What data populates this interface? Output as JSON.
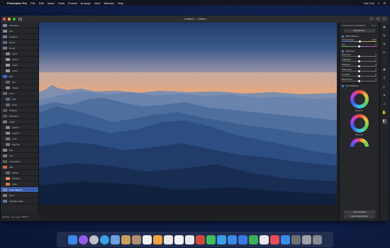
{
  "menubar": {
    "app_name": "Pixelmator Pro",
    "items": [
      "File",
      "Edit",
      "Insert",
      "Tools",
      "Format",
      "Arrange",
      "View",
      "Window",
      "Help"
    ],
    "clock": "Tue 9:41"
  },
  "window": {
    "title": "Untitled — Edited"
  },
  "layers": {
    "items": [
      {
        "label": "Adventure",
        "color": "#7a8aa0",
        "indent": false,
        "selected": false
      },
      {
        "label": "Line",
        "color": "#8a8a8a",
        "indent": false,
        "selected": false
      },
      {
        "label": "Gradient",
        "color": "#6a7a95",
        "indent": false,
        "selected": false
      },
      {
        "label": "Mount",
        "color": "#5a6a80",
        "indent": false,
        "selected": false
      },
      {
        "label": "Group",
        "color": "#777777",
        "indent": false,
        "selected": false
      },
      {
        "label": "Layer",
        "color": "#888888",
        "indent": true,
        "selected": false
      },
      {
        "label": "Cloud",
        "color": "#9a9a9a",
        "indent": true,
        "selected": false
      },
      {
        "label": "Cloud",
        "color": "#9a9a9a",
        "indent": true,
        "selected": false
      },
      {
        "label": "Cloud",
        "color": "#9a9a9a",
        "indent": true,
        "selected": false
      },
      {
        "label": "Blur",
        "color": "#3a6bd5",
        "indent": false,
        "selected": false
      },
      {
        "label": "Sky",
        "color": "#666666",
        "indent": true,
        "selected": false
      },
      {
        "label": "Image",
        "color": "#888888",
        "indent": true,
        "selected": false
      },
      {
        "label": "Tone",
        "color": "#666666",
        "indent": false,
        "selected": false
      },
      {
        "label": "Hills",
        "color": "#5a6a80",
        "indent": true,
        "selected": false
      },
      {
        "label": "Rock",
        "color": "#6a6a6a",
        "indent": true,
        "selected": false
      },
      {
        "label": "Shadow",
        "color": "#555555",
        "indent": false,
        "selected": false
      },
      {
        "label": "Shadows",
        "color": "#555555",
        "indent": false,
        "selected": false
      },
      {
        "label": "Lights",
        "color": "#777777",
        "indent": false,
        "selected": false
      },
      {
        "label": "Lights 1",
        "color": "#888888",
        "indent": true,
        "selected": false
      },
      {
        "label": "Lights 2",
        "color": "#888888",
        "indent": true,
        "selected": false
      },
      {
        "label": "Color",
        "color": "#777777",
        "indent": true,
        "selected": false
      },
      {
        "label": "Fog Tint",
        "color": "#777777",
        "indent": true,
        "selected": false
      },
      {
        "label": "Fog",
        "color": "#8a8a8a",
        "indent": false,
        "selected": false
      },
      {
        "label": "Tint",
        "color": "#7a7a7a",
        "indent": false,
        "selected": false
      },
      {
        "label": "Foreground",
        "color": "#5a5a5a",
        "indent": false,
        "selected": false
      },
      {
        "label": "Fills",
        "color": "#d06a4a",
        "indent": false,
        "selected": false
      },
      {
        "label": "Shade",
        "color": "#666666",
        "indent": true,
        "selected": false
      },
      {
        "label": "Gradient",
        "color": "#e08a5a",
        "indent": true,
        "selected": false
      },
      {
        "label": "Solid",
        "color": "#d07a4a",
        "indent": true,
        "selected": false
      },
      {
        "label": "Color Adjustm...",
        "color": "#8a8aaa",
        "indent": false,
        "selected": true
      },
      {
        "label": "Mont",
        "color": "#7a7a7a",
        "indent": false,
        "selected": false
      },
      {
        "label": "Original Image",
        "color": "#5a7aa0",
        "indent": false,
        "selected": false
      }
    ],
    "footer": {
      "blend_label": "Normal",
      "opacity_label": "100 %"
    }
  },
  "adjustments": {
    "title": "COLOR ADJUSTMENTS",
    "done_label": "Done",
    "auto_button": "ML Enhance",
    "white_balance": {
      "label": "White Balance",
      "temperature_label": "Temperature",
      "temperature_value": "-10 K",
      "tint_label": "Tint",
      "tint_value": "0",
      "temperature_pos": 0.52,
      "tint_pos": 0.5
    },
    "lightness": {
      "label": "Lightness",
      "rows": [
        {
          "label": "Exposure",
          "value": "0",
          "pos": 0.5
        },
        {
          "label": "Highlights",
          "value": "0",
          "pos": 0.5
        },
        {
          "label": "Shadows",
          "value": "0",
          "pos": 0.5
        },
        {
          "label": "Brightness",
          "value": "0",
          "pos": 0.5
        },
        {
          "label": "Contrast",
          "value": "0",
          "pos": 0.5
        },
        {
          "label": "Black Point",
          "value": "0",
          "pos": 0.5
        }
      ]
    },
    "color_balance": {
      "label": "Color Balance",
      "wheels": [
        "Shadows",
        "Midtones",
        "Highlights"
      ]
    },
    "show_original": "Show Original",
    "reset_button": "Reset Adjustments"
  },
  "tools": [
    "arrange-tool-icon",
    "style-tool-icon",
    "crop-tool-icon",
    "brush-tool-icon",
    "selection-tool-icon",
    "retouch-tool-icon",
    "type-tool-icon",
    "adjustments-tool-icon",
    "effects-tool-icon",
    "zoom-tool-icon",
    "hand-tool-icon",
    "color-adjust-tool-icon"
  ],
  "dock": {
    "apps": [
      {
        "name": "finder-icon",
        "color": "#3a8ae8"
      },
      {
        "name": "siri-icon",
        "color": "#9a5ae8"
      },
      {
        "name": "launchpad-icon",
        "color": "#c0c0c8"
      },
      {
        "name": "safari-icon",
        "color": "#3aa0e8"
      },
      {
        "name": "photos-icon-blue",
        "color": "#6aa0e0"
      },
      {
        "name": "notes-icon",
        "color": "#c8a05a"
      },
      {
        "name": "contacts-icon",
        "color": "#b09070"
      },
      {
        "name": "calendar-icon",
        "color": "#f0f0f0"
      },
      {
        "name": "photos-icon",
        "color": "#f0a040"
      },
      {
        "name": "maps-icon",
        "color": "#e8e8e8"
      },
      {
        "name": "reminders-icon",
        "color": "#f4f4f4"
      },
      {
        "name": "messages-icon",
        "color": "#e8e8f0"
      },
      {
        "name": "facetime-icon",
        "color": "#d04a3a"
      },
      {
        "name": "itunes-icon",
        "color": "#3ac05a"
      },
      {
        "name": "books-icon",
        "color": "#3aa0e8"
      },
      {
        "name": "app-store-icon",
        "color": "#3a8ae8"
      },
      {
        "name": "keynote-icon",
        "color": "#3a7ae8"
      },
      {
        "name": "numbers-icon",
        "color": "#3ab05a"
      },
      {
        "name": "music-icon",
        "color": "#e8e8e8"
      },
      {
        "name": "news-icon",
        "color": "#e84a5a"
      },
      {
        "name": "system-preferences-icon",
        "color": "#3a8ae8"
      },
      {
        "name": "pixelmator-icon",
        "color": "#707070"
      },
      {
        "name": "folder-icon",
        "color": "#a0a0a8"
      },
      {
        "name": "trash-icon",
        "color": "#888890"
      }
    ]
  },
  "colors": {
    "accent": "#3a7bd5",
    "panel": "#26272b",
    "selection": "#3a5fa8"
  }
}
